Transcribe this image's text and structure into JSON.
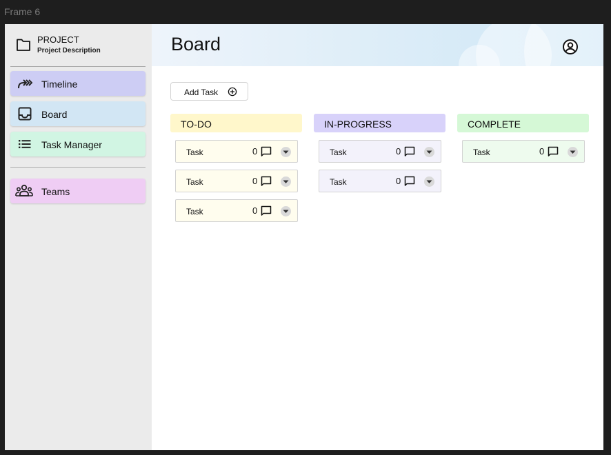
{
  "frame_label": "Frame 6",
  "project": {
    "name": "PROJECT",
    "description": "Project Description"
  },
  "sidebar": {
    "items": [
      {
        "label": "Timeline",
        "icon": "timeline-arrows-icon",
        "color": "#cdcdf4"
      },
      {
        "label": "Board",
        "icon": "inbox-icon",
        "color": "#d2e6f4"
      },
      {
        "label": "Task Manager",
        "icon": "list-icon",
        "color": "#d1f5e3"
      },
      {
        "label": "Teams",
        "icon": "groups-icon",
        "color": "#efcdf4"
      }
    ]
  },
  "header": {
    "title": "Board",
    "user_icon": "account-circle-icon"
  },
  "add_task": {
    "label": "Add Task",
    "icon": "plus-circle-icon"
  },
  "columns": [
    {
      "title": "TO-DO",
      "header_color": "#fff7cb",
      "card_color": "#fffdee",
      "cards": [
        {
          "label": "Task",
          "count": "0"
        },
        {
          "label": "Task",
          "count": "0"
        },
        {
          "label": "Task",
          "count": "0"
        }
      ]
    },
    {
      "title": "IN-PROGRESS",
      "header_color": "#d8d2fa",
      "card_color": "#f3f2fb",
      "cards": [
        {
          "label": "Task",
          "count": "0"
        },
        {
          "label": "Task",
          "count": "0"
        }
      ]
    },
    {
      "title": "COMPLETE",
      "header_color": "#d5f8d6",
      "card_color": "#eefbee",
      "cards": [
        {
          "label": "Task",
          "count": "0"
        }
      ]
    }
  ]
}
